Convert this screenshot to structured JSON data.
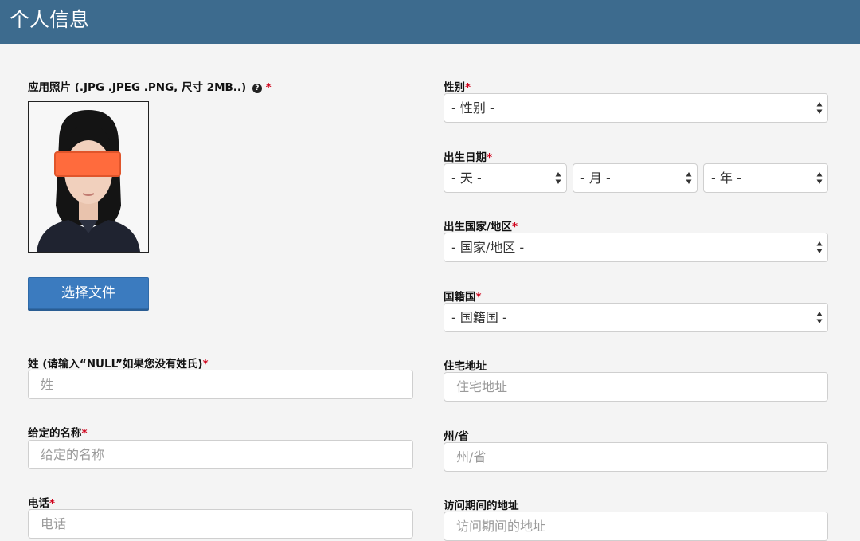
{
  "header": {
    "title": "个人信息"
  },
  "photo": {
    "label": "应用照片 (.JPG .JPEG .PNG, 尺寸 2MB..)",
    "help_icon_glyph": "?",
    "required_mark": "*",
    "choose_file_label": "选择文件"
  },
  "surname": {
    "label": "姓 (请输入“NULL”如果您没有姓氏)",
    "required_mark": "*",
    "placeholder": "姓"
  },
  "given_name": {
    "label": "给定的名称",
    "required_mark": "*",
    "placeholder": "给定的名称"
  },
  "phone": {
    "label": "电话",
    "required_mark": "*",
    "placeholder": "电话"
  },
  "gender": {
    "label": "性别",
    "required_mark": "*",
    "selected": "- 性别 -"
  },
  "birth_date": {
    "label": "出生日期",
    "required_mark": "*",
    "day": "- 天 -",
    "month": "- 月 -",
    "year": "- 年 -"
  },
  "birth_country": {
    "label": "出生国家/地区",
    "required_mark": "*",
    "selected": "- 国家/地区 -"
  },
  "nationality": {
    "label": "国籍国",
    "required_mark": "*",
    "selected": "- 国籍国 -"
  },
  "home_address": {
    "label": "住宅地址",
    "placeholder": "住宅地址"
  },
  "state": {
    "label": "州/省",
    "placeholder": "州/省"
  },
  "visit_address": {
    "label": "访问期间的地址",
    "placeholder": "访问期间的地址"
  },
  "colors": {
    "header_bg": "#3d6b8e",
    "button_bg": "#3b7bbf",
    "required": "#d0021b",
    "redaction": "#ff6b3d"
  }
}
